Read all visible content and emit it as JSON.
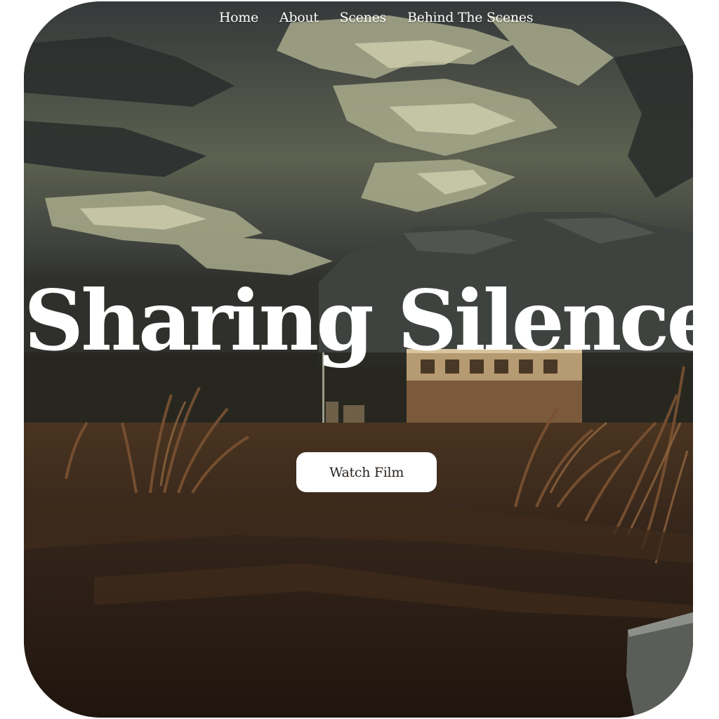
{
  "nav": {
    "items": [
      {
        "label": "Home"
      },
      {
        "label": "About"
      },
      {
        "label": "Scenes"
      },
      {
        "label": "Behind The Scenes"
      }
    ]
  },
  "hero": {
    "title": "Sharing Silence",
    "cta_label": "Watch Film"
  },
  "colors": {
    "sky_dark": "#3a3d3a",
    "sky_light": "#b8b89a",
    "ground": "#2a1d14",
    "grass": "#6b4a2b",
    "button_bg": "#ffffff",
    "text": "#ffffff"
  }
}
